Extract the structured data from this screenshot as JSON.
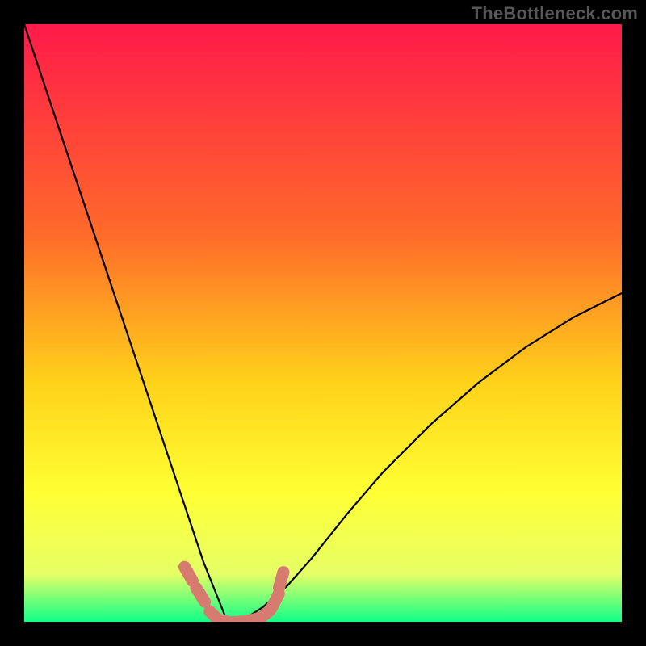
{
  "watermark": "TheBottleneck.com",
  "colors": {
    "black": "#000000",
    "curve": "#000000",
    "marker_fill": "#d77a70",
    "marker_stroke": "#d77a70",
    "grad_top": "#ff1a4a",
    "grad_mid1": "#ff6a2a",
    "grad_mid2": "#ffd21a",
    "grad_mid3": "#ffff33",
    "grad_mid4": "#e6ff66",
    "grad_bottom": "#10ff88"
  },
  "chart_data": {
    "type": "line",
    "title": "",
    "xlabel": "",
    "ylabel": "",
    "xlim": [
      0,
      100
    ],
    "ylim": [
      0,
      100
    ],
    "notes": "V-shaped bottleneck curve; y≈100 at x≈0, drops steeply to y≈0 near x≈34, rises smoothly to y≈55 at x=100. Salmon markers sit along the trough region near y≈0–8.",
    "series": [
      {
        "name": "curve",
        "x": [
          0,
          4,
          8,
          12,
          16,
          20,
          23,
          26,
          28,
          30,
          32,
          33,
          34,
          35,
          36,
          38,
          40,
          44,
          48,
          54,
          60,
          68,
          76,
          84,
          92,
          100
        ],
        "y": [
          100,
          88,
          76,
          64,
          52,
          40,
          31,
          22,
          16,
          10,
          5,
          2.5,
          0,
          0.2,
          0.5,
          1.2,
          2.5,
          6,
          10.5,
          18,
          25,
          33,
          40,
          46,
          51,
          55
        ]
      }
    ],
    "markers": {
      "name": "trough-points",
      "x": [
        27.5,
        29.5,
        32,
        34,
        36,
        38,
        40,
        42,
        43
      ],
      "y": [
        8,
        4.5,
        0.8,
        0,
        0,
        0.3,
        1,
        3.5,
        7
      ]
    }
  }
}
